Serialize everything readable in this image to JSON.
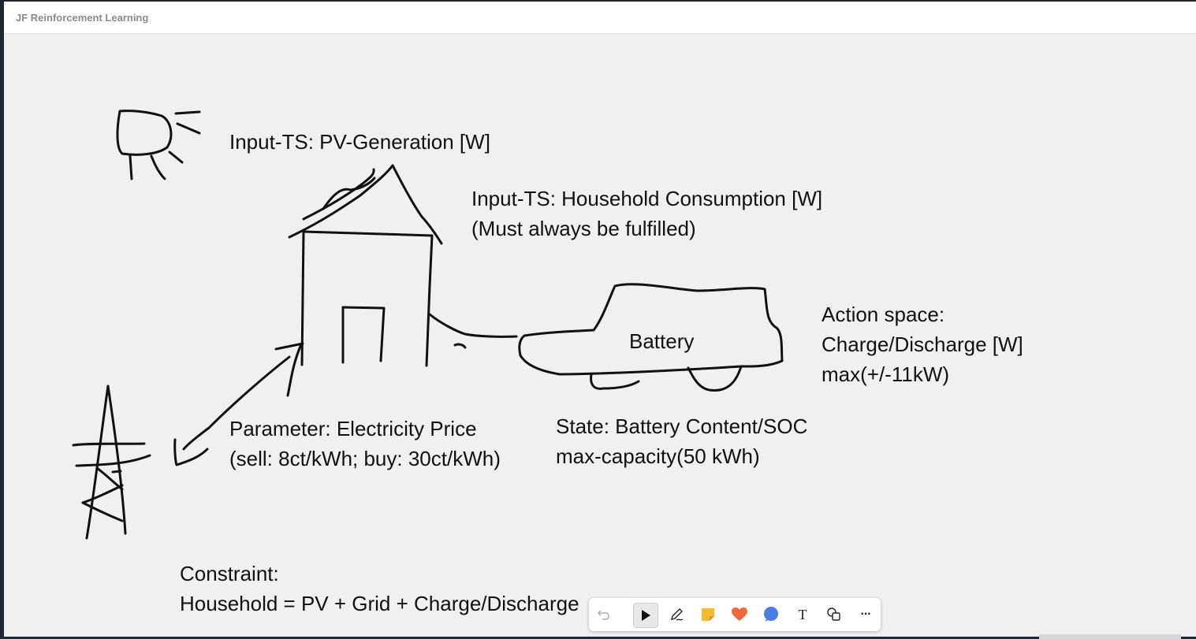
{
  "window": {
    "title": "JF Reinforcement Learning"
  },
  "whiteboard": {
    "pv_label": "Input-TS: PV-Generation [W]",
    "household_label_1": "Input-TS: Household Consumption [W]",
    "household_label_2": "(Must always be fulfilled)",
    "battery_label": "Battery",
    "action_1": "Action space:",
    "action_2": "Charge/Discharge [W]",
    "action_3": "max(+/-11kW)",
    "price_1": "Parameter: Electricity Price",
    "price_2": "(sell:  8ct/kWh; buy: 30ct/kWh)",
    "state_1": "State: Battery Content/SOC",
    "state_2": "max-capacity(50 kWh)",
    "constraint_1": "Constraint:",
    "constraint_2": "Household = PV + Grid + Charge/Discharge"
  },
  "toolbar": {
    "tools": [
      "undo-icon",
      "select-icon",
      "pen-icon",
      "sticky-note-icon",
      "reaction-heart-icon",
      "comment-icon",
      "text-icon",
      "shapes-icon",
      "more-icon"
    ],
    "text_tool_glyph": "T",
    "more_glyph": "···",
    "colors": {
      "sticky": "#f7b92d",
      "heart": "#ef6a3a",
      "comment": "#4a7de0"
    }
  }
}
